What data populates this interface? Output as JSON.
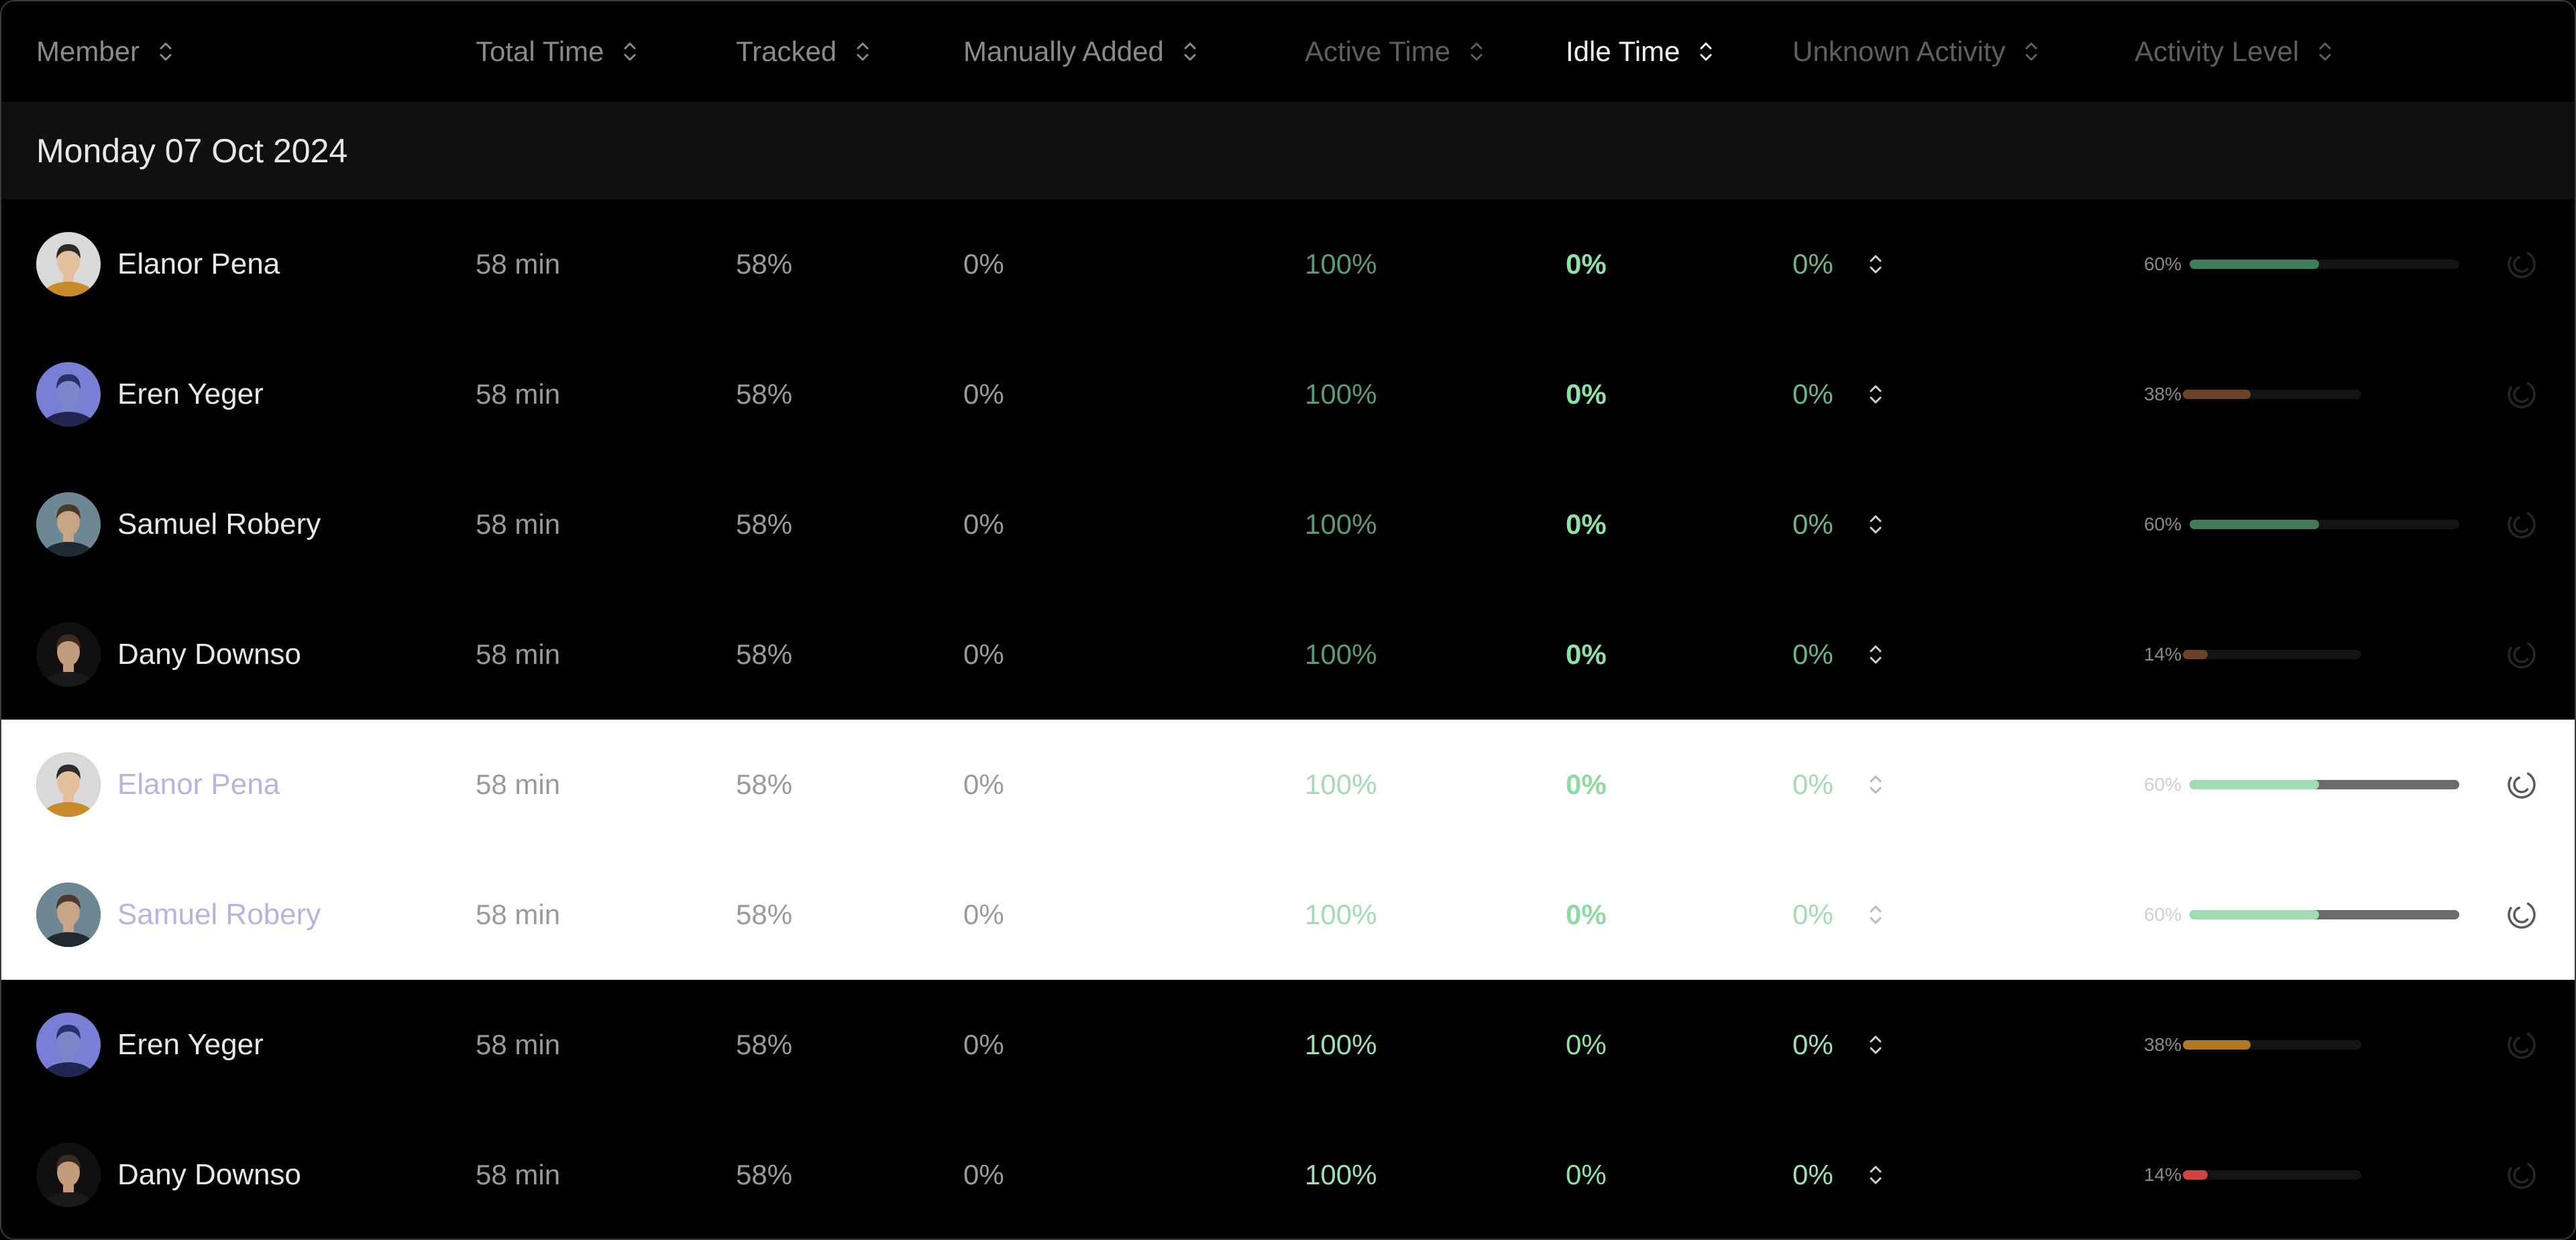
{
  "columns": [
    {
      "label": "Member"
    },
    {
      "label": "Total Time"
    },
    {
      "label": "Tracked"
    },
    {
      "label": "Manually Added"
    },
    {
      "label": "Active Time"
    },
    {
      "label": "Idle Time"
    },
    {
      "label": "Unknown Activity"
    },
    {
      "label": "Activity Level"
    }
  ],
  "group": {
    "label": "Monday 07 Oct 2024"
  },
  "rows": [
    {
      "name": "Elanor Pena",
      "total": "58 min",
      "tracked": "58%",
      "manual": "0%",
      "active": "100%",
      "idle": "0%",
      "unknown": "0%",
      "level_label": "60%",
      "level": 0.6,
      "level_color": "#3f7d5a"
    },
    {
      "name": "Eren Yeger",
      "total": "58 min",
      "tracked": "58%",
      "manual": "0%",
      "active": "100%",
      "idle": "0%",
      "unknown": "0%",
      "level_label": "38%",
      "level": 0.38,
      "level_color": "#6b4226"
    },
    {
      "name": "Samuel Robery",
      "total": "58 min",
      "tracked": "58%",
      "manual": "0%",
      "active": "100%",
      "idle": "0%",
      "unknown": "0%",
      "level_label": "60%",
      "level": 0.6,
      "level_color": "#3f7d5a"
    },
    {
      "name": "Dany Downso",
      "total": "58 min",
      "tracked": "58%",
      "manual": "0%",
      "active": "100%",
      "idle": "0%",
      "unknown": "0%",
      "level_label": "14%",
      "level": 0.14,
      "level_color": "#6b4226"
    },
    {
      "name": "Elanor Pena",
      "total": "58 min",
      "tracked": "58%",
      "manual": "0%",
      "active": "100%",
      "idle": "0%",
      "unknown": "0%",
      "level_label": "60%",
      "level": 0.6,
      "level_color": "#9fdcb2"
    },
    {
      "name": "Samuel Robery",
      "total": "58 min",
      "tracked": "58%",
      "manual": "0%",
      "active": "100%",
      "idle": "0%",
      "unknown": "0%",
      "level_label": "60%",
      "level": 0.6,
      "level_color": "#9fdcb2"
    },
    {
      "name": "Eren Yeger",
      "total": "58 min",
      "tracked": "58%",
      "manual": "0%",
      "active": "100%",
      "idle": "0%",
      "unknown": "0%",
      "level_label": "38%",
      "level": 0.38,
      "level_color": "#b07a22"
    },
    {
      "name": "Dany Downso",
      "total": "58 min",
      "tracked": "58%",
      "manual": "0%",
      "active": "100%",
      "idle": "0%",
      "unknown": "0%",
      "level_label": "14%",
      "level": 0.14,
      "level_color": "#d0463f"
    }
  ],
  "icons": {
    "sort": "sort-updown-icon",
    "activity": "activity-ring-icon"
  }
}
